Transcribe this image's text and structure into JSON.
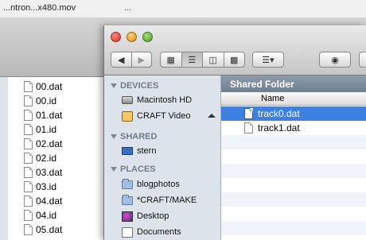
{
  "background_window": {
    "title": "...ntron...x480.mov",
    "title2": "...",
    "files": [
      "00.dat",
      "00.id",
      "01.dat",
      "01.id",
      "02.dat",
      "02.id",
      "03.dat",
      "03.id",
      "04.dat",
      "04.id",
      "05.dat"
    ]
  },
  "finder": {
    "folder_title": "Shared Folder",
    "column_header": "Name",
    "toolbar": {
      "back_icon": "back-arrow-icon",
      "forward_icon": "forward-arrow-icon",
      "view_icons": [
        "icon-view-icon",
        "list-view-icon",
        "column-view-icon",
        "coverflow-view-icon"
      ],
      "action_icon": "gear-menu-icon",
      "quicklook_icon": "eye-icon"
    },
    "sidebar": {
      "devices_label": "DEVICES",
      "devices": [
        "Macintosh HD",
        "CRAFT Video"
      ],
      "shared_label": "SHARED",
      "shared": [
        "stern"
      ],
      "places_label": "PLACES",
      "places": [
        "blogphotos",
        "*CRAFT/MAKE",
        "Desktop",
        "Documents"
      ]
    },
    "files": [
      "track0.dat",
      "track1.dat"
    ],
    "selected_file": "track0.dat",
    "colors": {
      "selection": "#3d80df",
      "title_bar": "#7f8ea1",
      "sidebar": "#dde3ea"
    }
  }
}
